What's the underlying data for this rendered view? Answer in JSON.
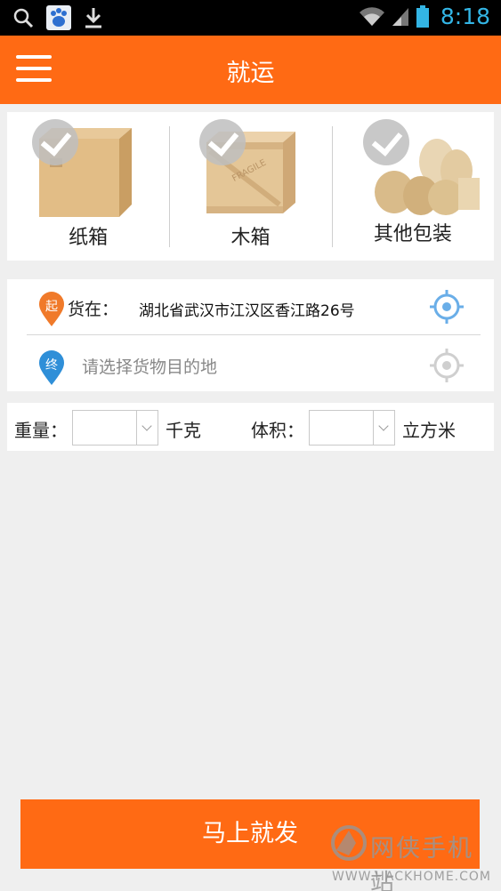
{
  "status_bar": {
    "time": "8:18",
    "icons": [
      "search-icon",
      "baidu-app-icon",
      "download-icon",
      "wifi-icon",
      "signal-icon",
      "battery-icon"
    ]
  },
  "header": {
    "title": "就运",
    "menu_icon": "menu-icon"
  },
  "packages": [
    {
      "label": "纸箱",
      "icon": "cardboard-box"
    },
    {
      "label": "木箱",
      "icon": "wooden-crate"
    },
    {
      "label": "其他包装",
      "icon": "sacks"
    }
  ],
  "location": {
    "from_marker": "起",
    "from_label": "货在：",
    "from_value": "湖北省武汉市江汉区香江路26号",
    "to_marker": "终",
    "to_placeholder": "请选择货物目的地"
  },
  "measure": {
    "weight_label": "重量：",
    "weight_value": "",
    "weight_unit": "千克",
    "volume_label": "体积：",
    "volume_value": "",
    "volume_unit": "立方米"
  },
  "action": {
    "submit_label": "马上就发"
  },
  "watermark": {
    "text": "网侠手机站",
    "url": "WWW.HACKHOME.COM"
  },
  "colors": {
    "accent": "#ff6a14",
    "from_pin": "#f07a2a",
    "to_pin": "#2f8fd8",
    "status_blue": "#33b5e5"
  }
}
